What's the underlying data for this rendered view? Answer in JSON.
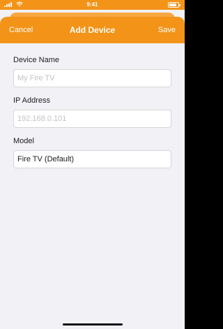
{
  "status_bar": {
    "time": "9:41"
  },
  "navbar": {
    "cancel_label": "Cancel",
    "title": "Add Device",
    "save_label": "Save"
  },
  "form": {
    "device_name": {
      "label": "Device Name",
      "placeholder": "My Fire TV",
      "value": ""
    },
    "ip_address": {
      "label": "IP Address",
      "placeholder": "192.168.0.101",
      "value": ""
    },
    "model": {
      "label": "Model",
      "value": "Fire TV (Default)"
    }
  },
  "colors": {
    "accent": "#f39418",
    "background": "#f2f2f6"
  },
  "icons": [
    "cellular-signal-icon",
    "wifi-icon",
    "battery-icon"
  ]
}
